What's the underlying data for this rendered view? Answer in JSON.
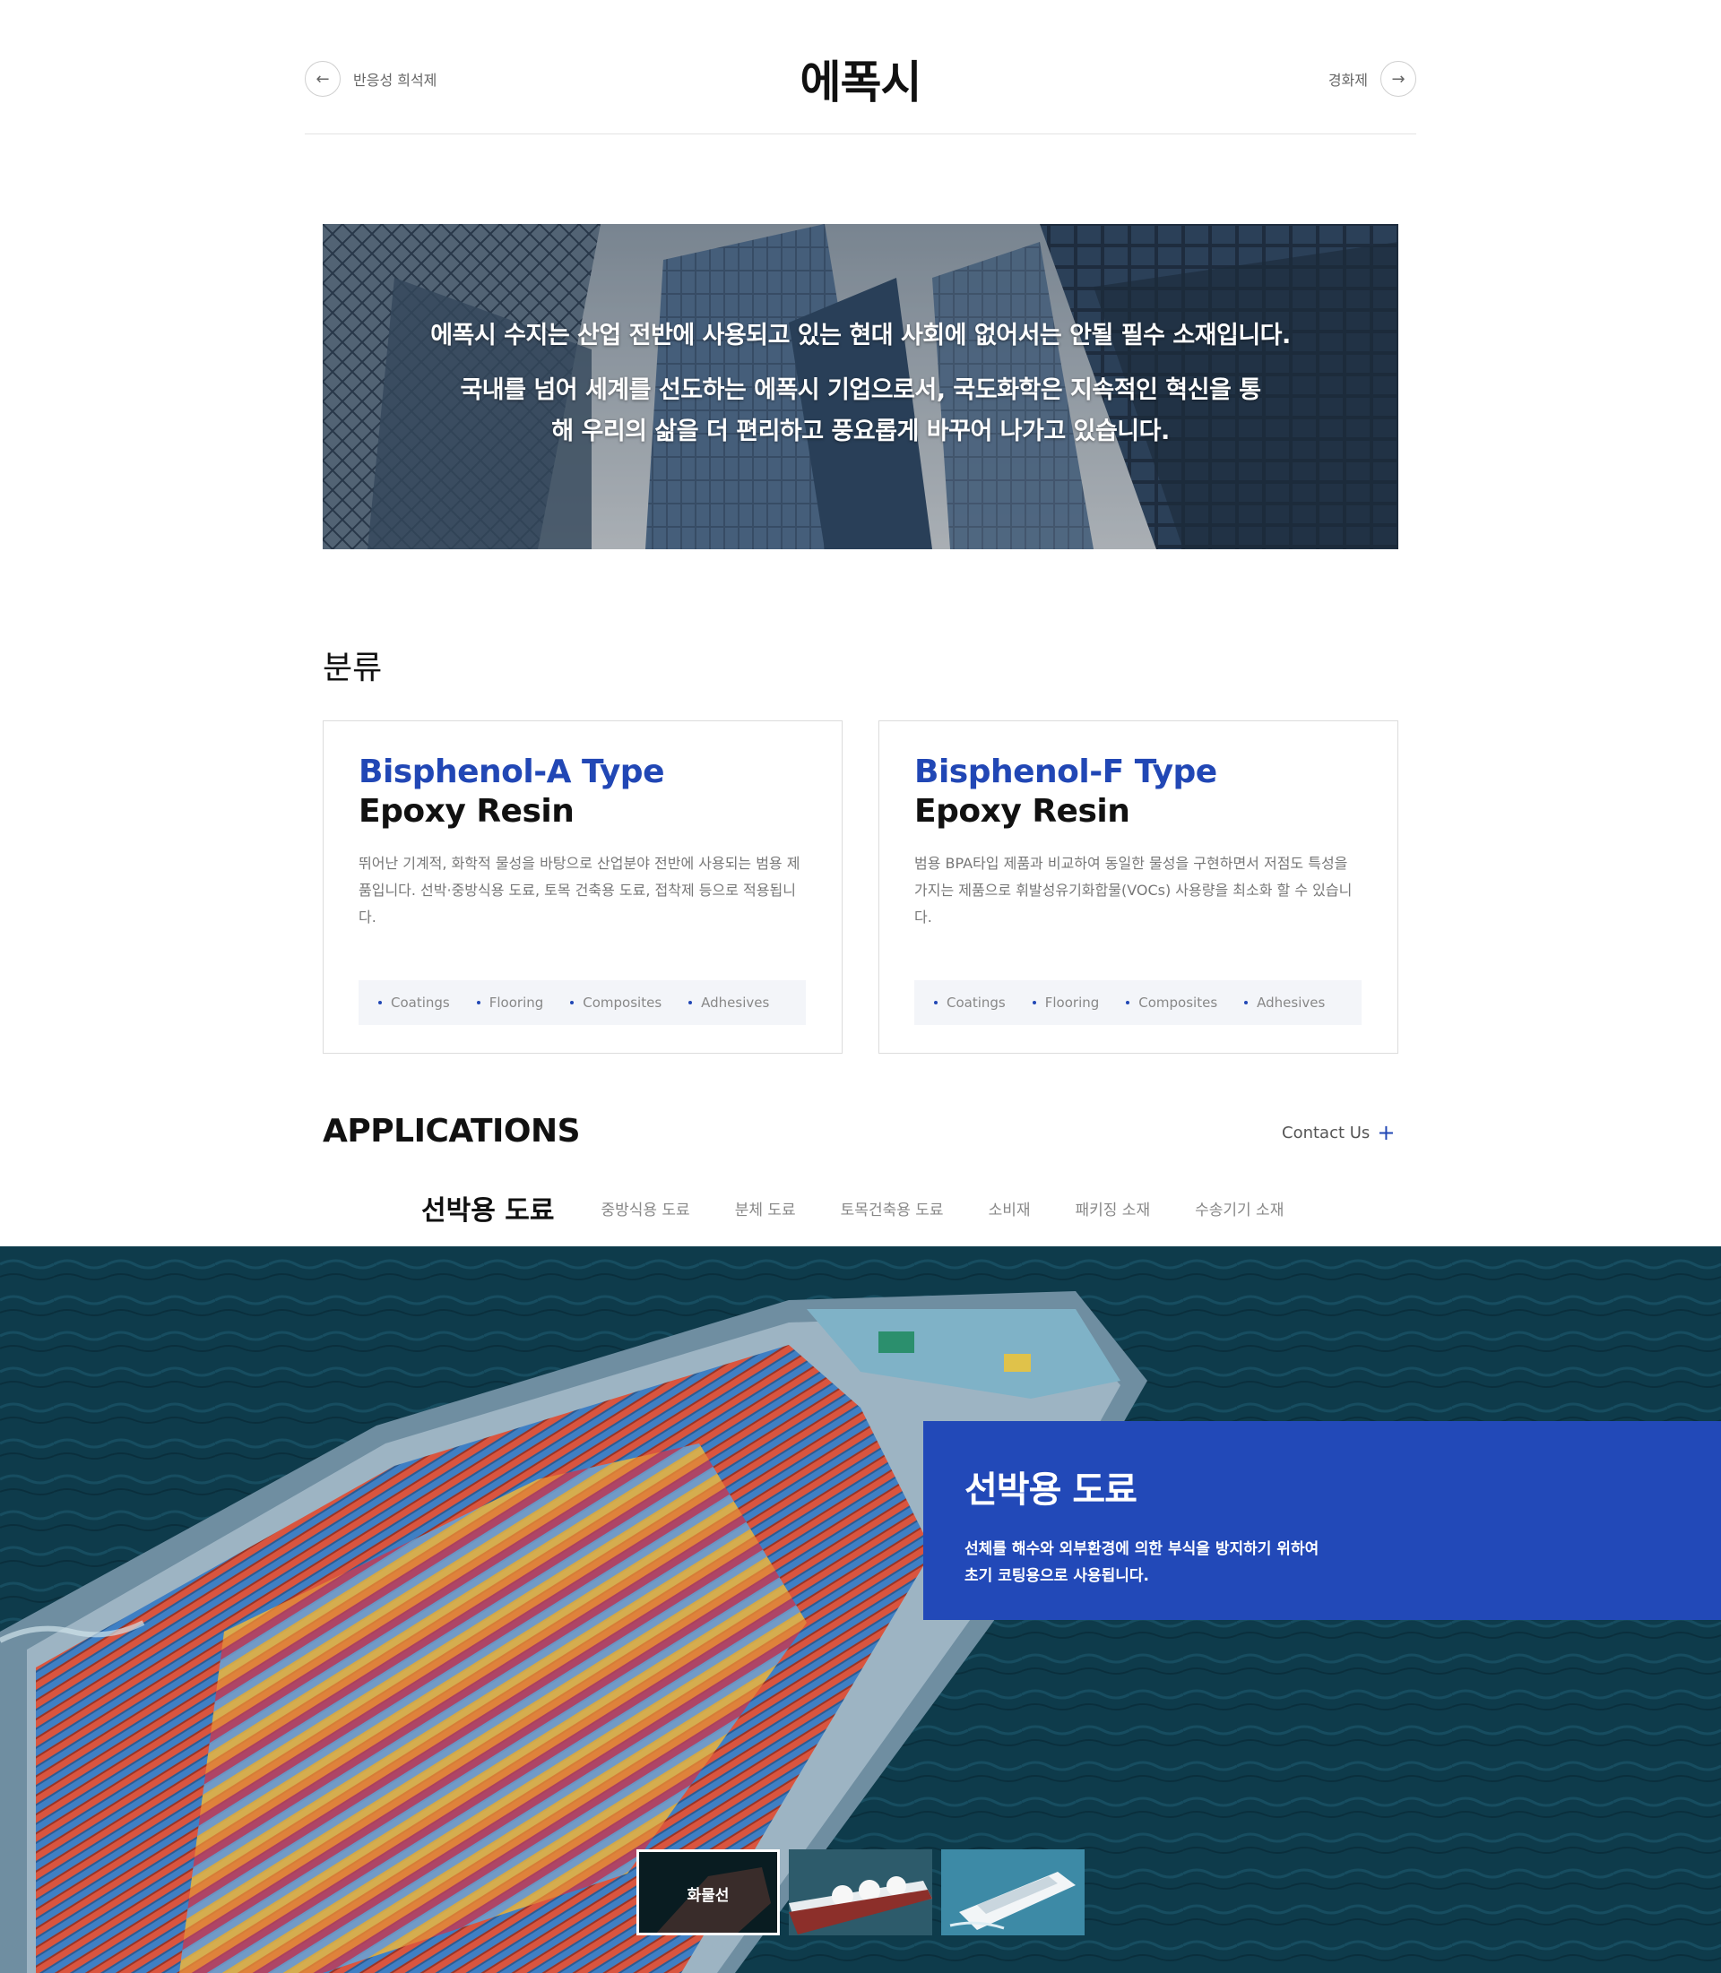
{
  "nav": {
    "prev_label": "반응성 희석제",
    "next_label": "경화제",
    "title": "에폭시"
  },
  "hero": {
    "line1": "에폭시 수지는 산업 전반에 사용되고 있는 현대 사회에 없어서는 안될 필수 소재입니다.",
    "line2": "국내를 넘어 세계를 선도하는 에폭시 기업으로서, 국도화학은 지속적인 혁신을 통해 우리의 삶을 더 편리하고 풍요롭게 바꾸어 나가고 있습니다."
  },
  "classification": {
    "heading": "분류",
    "cards": [
      {
        "title_type": "Bisphenol-A Type",
        "title_resin": "Epoxy Resin",
        "description": "뛰어난 기계적, 화학적 물성을 바탕으로 산업분야 전반에 사용되는 범용 제품입니다. 선박·중방식용 도료, 토목 건축용 도료, 접착제 등으로 적용됩니다.",
        "tags": [
          "Coatings",
          "Flooring",
          "Composites",
          "Adhesives"
        ]
      },
      {
        "title_type": "Bisphenol-F Type",
        "title_resin": "Epoxy Resin",
        "description": "범용 BPA타입 제품과 비교하여 동일한 물성을 구현하면서 저점도 특성을 가지는 제품으로 휘발성유기화합물(VOCs) 사용량을 최소화 할 수 있습니다.",
        "tags": [
          "Coatings",
          "Flooring",
          "Composites",
          "Adhesives"
        ]
      }
    ]
  },
  "applications": {
    "heading": "APPLICATIONS",
    "contact_label": "Contact Us",
    "tabs": [
      "선박용 도료",
      "중방식용 도료",
      "분체 도료",
      "토목건축용 도료",
      "소비재",
      "패키징 소재",
      "수송기기 소재"
    ],
    "active_tab": 0,
    "panel": {
      "title": "선박용 도료",
      "description_line1": "선체를 해수와 외부환경에 의한 부식을 방지하기 위하여",
      "description_line2": "초기 코팅용으로 사용됩니다."
    },
    "thumbnails": [
      {
        "label": "화물선",
        "active": true
      },
      {
        "label": "",
        "active": false
      },
      {
        "label": "",
        "active": false
      }
    ]
  },
  "colors": {
    "accent": "#2147b5",
    "panel": "#2249b8",
    "sea": "#0d3a4a"
  },
  "icons": {
    "prev": "arrow-left-icon",
    "next": "arrow-right-icon",
    "contact": "plus-icon"
  }
}
